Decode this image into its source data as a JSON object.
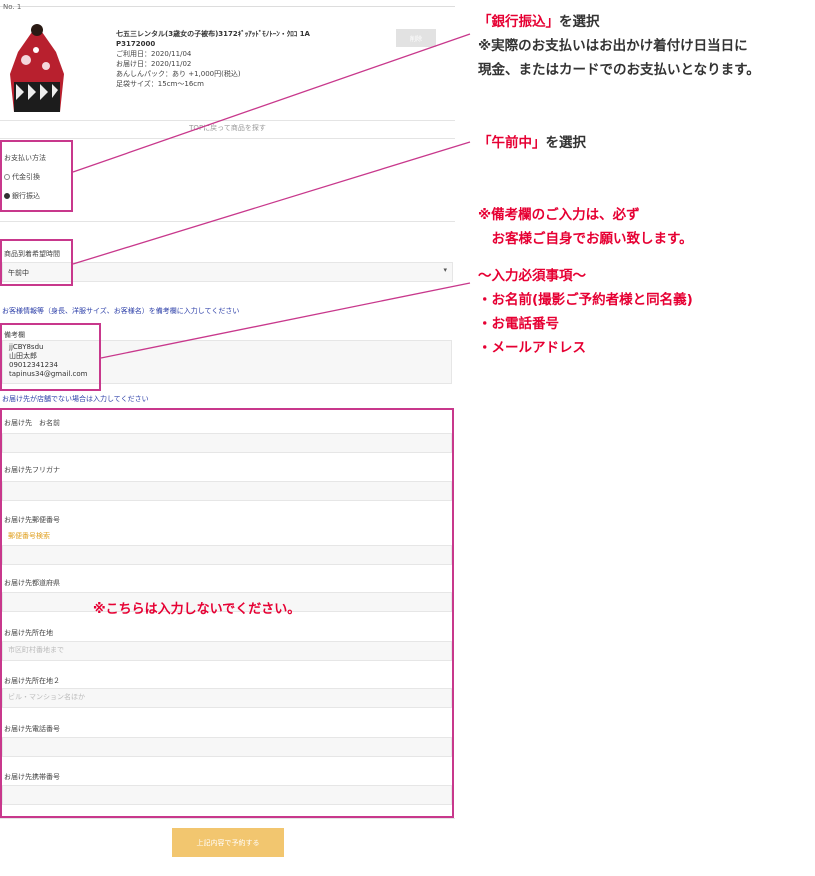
{
  "product": {
    "item_no": "No. 1",
    "name": "七五三レンタル(3歳女の子被布)3172ｷﾞｯｱｯﾄﾞﾓﾉﾄｰﾝ・ｸﾛｺ 1A",
    "code": "P3172000",
    "use_date": "ご利用日：2020/11/04",
    "delivery_date": "お届け日：2020/11/02",
    "anshin_pack": "あんしんパック：あり +1,000円(税込)",
    "foot_size": "足袋サイズ：15cm〜16cm",
    "delete_label": "削除"
  },
  "top_link": "TOPに戻って商品を探す",
  "payment": {
    "label": "お支払い方法",
    "options": [
      "代金引換",
      "銀行振込"
    ],
    "selected": "銀行振込"
  },
  "delivery_time": {
    "label": "商品到着希望時間",
    "value": "午前中"
  },
  "customer_notice": "お客様情報等（身長、洋服サイズ、お客様名）を備考欄に入力してください",
  "remarks": {
    "label": "備考欄",
    "lines": [
      "jjCBY8sdu",
      "山田太郎",
      "09012341234",
      "tapinus34@gmail.com"
    ]
  },
  "shipping_notice": "お届け先が店舗でない場合は入力してください",
  "shipping_fields": {
    "name": "お届け先　お名前",
    "kana": "お届け先フリガナ",
    "zip": "お届け先郵便番号",
    "zip_search": "郵便番号検索",
    "pref": "お届け先都道府県",
    "addr1": "お届け先所在地",
    "addr1_placeholder": "市区町村番地まで",
    "addr2": "お届け先所在地２",
    "addr2_placeholder": "ビル・マンション名ほか",
    "tel": "お届け先電話番号",
    "mobile": "お届け先携帯番号"
  },
  "submit_label": "上記内容で予約する",
  "annotations": {
    "a1_highlight": "「銀行振込」",
    "a1_rest": "を選択",
    "a1_line2": "※実際のお支払いはお出かけ着付け日当日に",
    "a1_line3": "現金、またはカードでのお支払いとなります。",
    "a2_highlight": "「午前中」",
    "a2_rest": "を選択",
    "a3_line1": "※備考欄のご入力は、必ず",
    "a3_line2": "　お客様ご自身でお願い致します。",
    "a4_line1": "〜入力必須事項〜",
    "a4_line2": "・お名前(撮影ご予約者様と同名義)",
    "a4_line3": "・お電話番号",
    "a4_line4": "・メールアドレス",
    "warning": "※こちらは入力しないでください。"
  },
  "colors": {
    "highlight_border": "#c8388c",
    "annotation_red": "#e60033",
    "notice_blue": "#2c3fa8",
    "submit_button": "#f2c66f"
  }
}
